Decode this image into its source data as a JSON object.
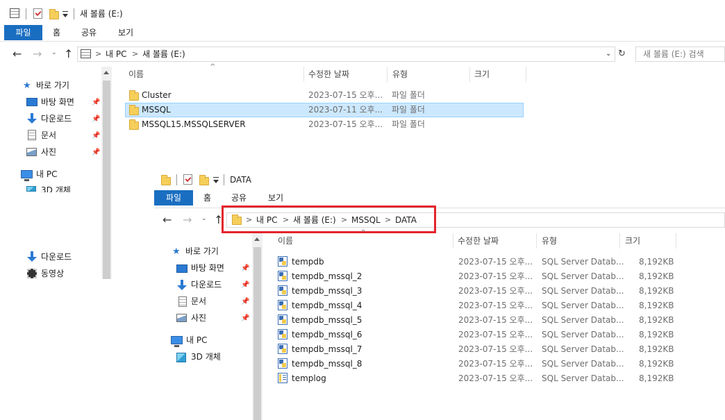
{
  "window1": {
    "title": "새 볼륨 (E:)",
    "ribbon_tabs": [
      "파일",
      "홈",
      "공유",
      "보기"
    ],
    "breadcrumb": [
      "내 PC",
      "새 볼륨 (E:)"
    ],
    "search_placeholder": "새 볼륨 (E:) 검색",
    "columns": [
      "이름",
      "수정한 날짜",
      "유형",
      "크기"
    ],
    "files": [
      {
        "name": "Cluster",
        "date": "2023-07-15 오후...",
        "type": "파일 폴더"
      },
      {
        "name": "MSSQL",
        "date": "2023-07-11 오후...",
        "type": "파일 폴더",
        "selected": true
      },
      {
        "name": "MSSQL15.MSSQLSERVER",
        "date": "2023-07-15 오후...",
        "type": "파일 폴더"
      }
    ],
    "nav": {
      "quick_access": "바로 가기",
      "items": [
        "바탕 화면",
        "다운로드",
        "문서",
        "사진"
      ],
      "this_pc": "내 PC",
      "objects_3d": "3D 개체",
      "lower_items": [
        "다운로드",
        "동영상"
      ]
    }
  },
  "window2": {
    "title": "DATA",
    "ribbon_tabs": [
      "파일",
      "홈",
      "공유",
      "보기"
    ],
    "breadcrumb": [
      "내 PC",
      "새 볼륨 (E:)",
      "MSSQL",
      "DATA"
    ],
    "columns": [
      "이름",
      "수정한 날짜",
      "유형",
      "크기"
    ],
    "files": [
      {
        "name": "tempdb",
        "date": "2023-07-15 오후...",
        "type": "SQL Server Datab...",
        "size": "8,192KB",
        "icon": "db"
      },
      {
        "name": "tempdb_mssql_2",
        "date": "2023-07-15 오후...",
        "type": "SQL Server Datab...",
        "size": "8,192KB",
        "icon": "db"
      },
      {
        "name": "tempdb_mssql_3",
        "date": "2023-07-15 오후...",
        "type": "SQL Server Datab...",
        "size": "8,192KB",
        "icon": "db"
      },
      {
        "name": "tempdb_mssql_4",
        "date": "2023-07-15 오후...",
        "type": "SQL Server Datab...",
        "size": "8,192KB",
        "icon": "db"
      },
      {
        "name": "tempdb_mssql_5",
        "date": "2023-07-15 오후...",
        "type": "SQL Server Datab...",
        "size": "8,192KB",
        "icon": "db"
      },
      {
        "name": "tempdb_mssql_6",
        "date": "2023-07-15 오후...",
        "type": "SQL Server Datab...",
        "size": "8,192KB",
        "icon": "db"
      },
      {
        "name": "tempdb_mssql_7",
        "date": "2023-07-15 오후...",
        "type": "SQL Server Datab...",
        "size": "8,192KB",
        "icon": "db"
      },
      {
        "name": "tempdb_mssql_8",
        "date": "2023-07-15 오후...",
        "type": "SQL Server Datab...",
        "size": "8,192KB",
        "icon": "db"
      },
      {
        "name": "templog",
        "date": "2023-07-15 오후...",
        "type": "SQL Server Datab...",
        "size": "8,192KB",
        "icon": "log"
      }
    ],
    "nav": {
      "quick_access": "바로 가기",
      "items": [
        "바탕 화면",
        "다운로드",
        "문서",
        "사진"
      ],
      "this_pc": "내 PC",
      "objects_3d": "3D 개체"
    }
  },
  "colors": {
    "accent": "#1a6ec1",
    "selection": "#cce8ff",
    "highlight": "#e3242b"
  }
}
